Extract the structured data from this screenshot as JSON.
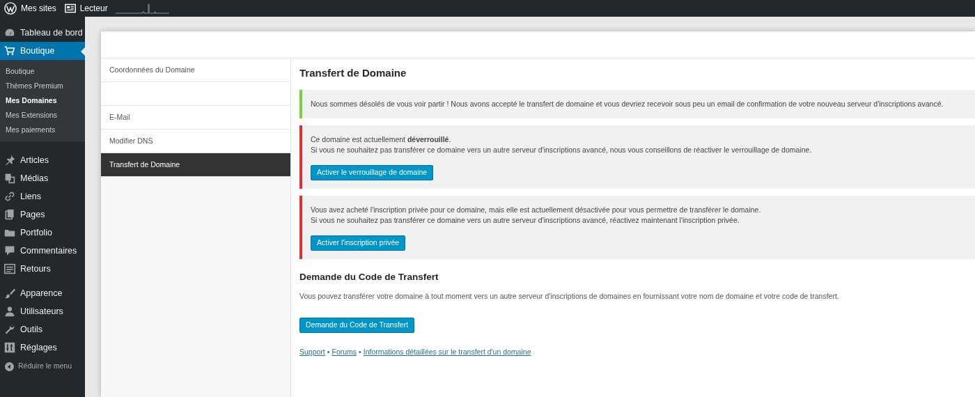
{
  "admin_bar": {
    "items": [
      {
        "kind": "sites",
        "label": "Mes sites"
      },
      {
        "kind": "reader",
        "label": "Lecteur"
      }
    ]
  },
  "sidebar": {
    "menu": [
      {
        "label": "Tableau de bord",
        "selected": false
      },
      {
        "label": "Boutique",
        "selected": true,
        "children": [
          {
            "label": "Boutique",
            "selected": false
          },
          {
            "label": "Thèmes Premium",
            "selected": false
          },
          {
            "label": "Mes Domaines",
            "selected": true
          },
          {
            "label": "Mes Extensions",
            "selected": false
          },
          {
            "label": "Mes paiements",
            "selected": false
          }
        ]
      },
      {
        "label": "Articles",
        "selected": false
      },
      {
        "label": "Médias",
        "selected": false
      },
      {
        "label": "Liens",
        "selected": false
      },
      {
        "label": "Pages",
        "selected": false
      },
      {
        "label": "Portfolio",
        "selected": false
      },
      {
        "label": "Commentaires",
        "selected": false
      },
      {
        "label": "Retours",
        "selected": false
      },
      {
        "label": "Apparence",
        "selected": false
      },
      {
        "label": "Utilisateurs",
        "selected": false
      },
      {
        "label": "Outils",
        "selected": false
      },
      {
        "label": "Réglages",
        "selected": false
      }
    ],
    "collapse": "Réduire le menu"
  },
  "modal": {
    "nav": [
      {
        "kind": "link",
        "label": "Coordonnées du Domaine",
        "selected": false
      },
      {
        "kind": "blank",
        "selected": false
      },
      {
        "kind": "link",
        "label": "E-Mail",
        "selected": false
      },
      {
        "kind": "link",
        "label": "Modifier DNS",
        "selected": false
      },
      {
        "kind": "link",
        "label": "Transfert de Domaine",
        "selected": true
      }
    ],
    "title": "Transfert de Domaine",
    "notices": [
      {
        "kind": "success",
        "lines": [
          "Nous sommes désolés de vous voir partir ! Nous avons accepté le transfert de domaine et vous devriez recevoir sous peu un email de confirmation de votre nouveau serveur d'inscriptions avancé."
        ]
      },
      {
        "kind": "error",
        "lines": [
          "Ce domaine est actuellement **déverrouillé**.",
          "Si vous ne souhaitez pas transférer ce domaine vers un autre serveur d'inscriptions avancé, nous vous conseillons de réactiver le verrouillage de domaine."
        ],
        "button": "Activer le verrouillage de domaine"
      },
      {
        "kind": "error",
        "lines": [
          "Vous avez acheté l'inscription privée pour ce domaine, mais elle est actuellement désactivée pour vous permettre de transférer le domaine.",
          "Si vous ne souhaitez pas transférer ce domaine vers un autre serveur d'inscriptions avancé, réactivez maintenant l'inscription privée."
        ],
        "button": "Activer l'inscription privée"
      }
    ],
    "section": {
      "title": "Demande du Code de Transfert",
      "text": "Vous pouvez transférer votre domaine à tout moment vers un autre serveur d'inscriptions de domaines en fournissant votre nom de domaine et votre code de transfert.",
      "button": "Demande du Code de Transfert"
    },
    "links": [
      {
        "kind": "link",
        "label": "Support"
      },
      {
        "kind": "separator",
        "label": "•"
      },
      {
        "kind": "link",
        "label": "Forums"
      },
      {
        "kind": "separator",
        "label": "•"
      },
      {
        "kind": "link",
        "label": "Informations détaillées sur le transfert d'un domaine"
      }
    ]
  }
}
